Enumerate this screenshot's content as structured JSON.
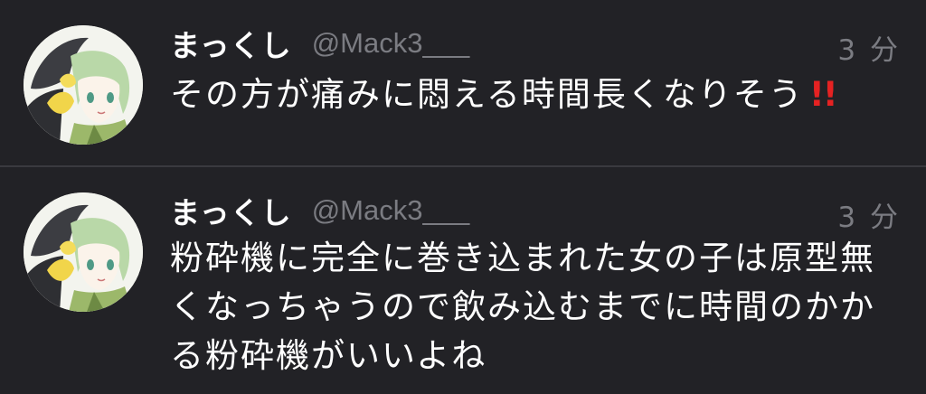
{
  "tweets": [
    {
      "display_name": "まっくし",
      "handle": "@Mack3___",
      "time": "3 分",
      "text": "その方が痛みに悶える時間長くなりそう",
      "emoji": "‼️",
      "avatar_icon": "anime-avatar-icon"
    },
    {
      "display_name": "まっくし",
      "handle": "@Mack3___",
      "time": "3 分",
      "text": "粉砕機に完全に巻き込まれた女の子は原型無くなっちゃうので飲み込むまでに時間のかかる粉砕機がいいよね",
      "avatar_icon": "anime-avatar-icon"
    }
  ],
  "colors": {
    "background": "#222226",
    "divider": "#3a3a3f",
    "secondary_text": "#7b7c82",
    "primary_text": "#ffffff",
    "emoji_red": "#e52222"
  }
}
